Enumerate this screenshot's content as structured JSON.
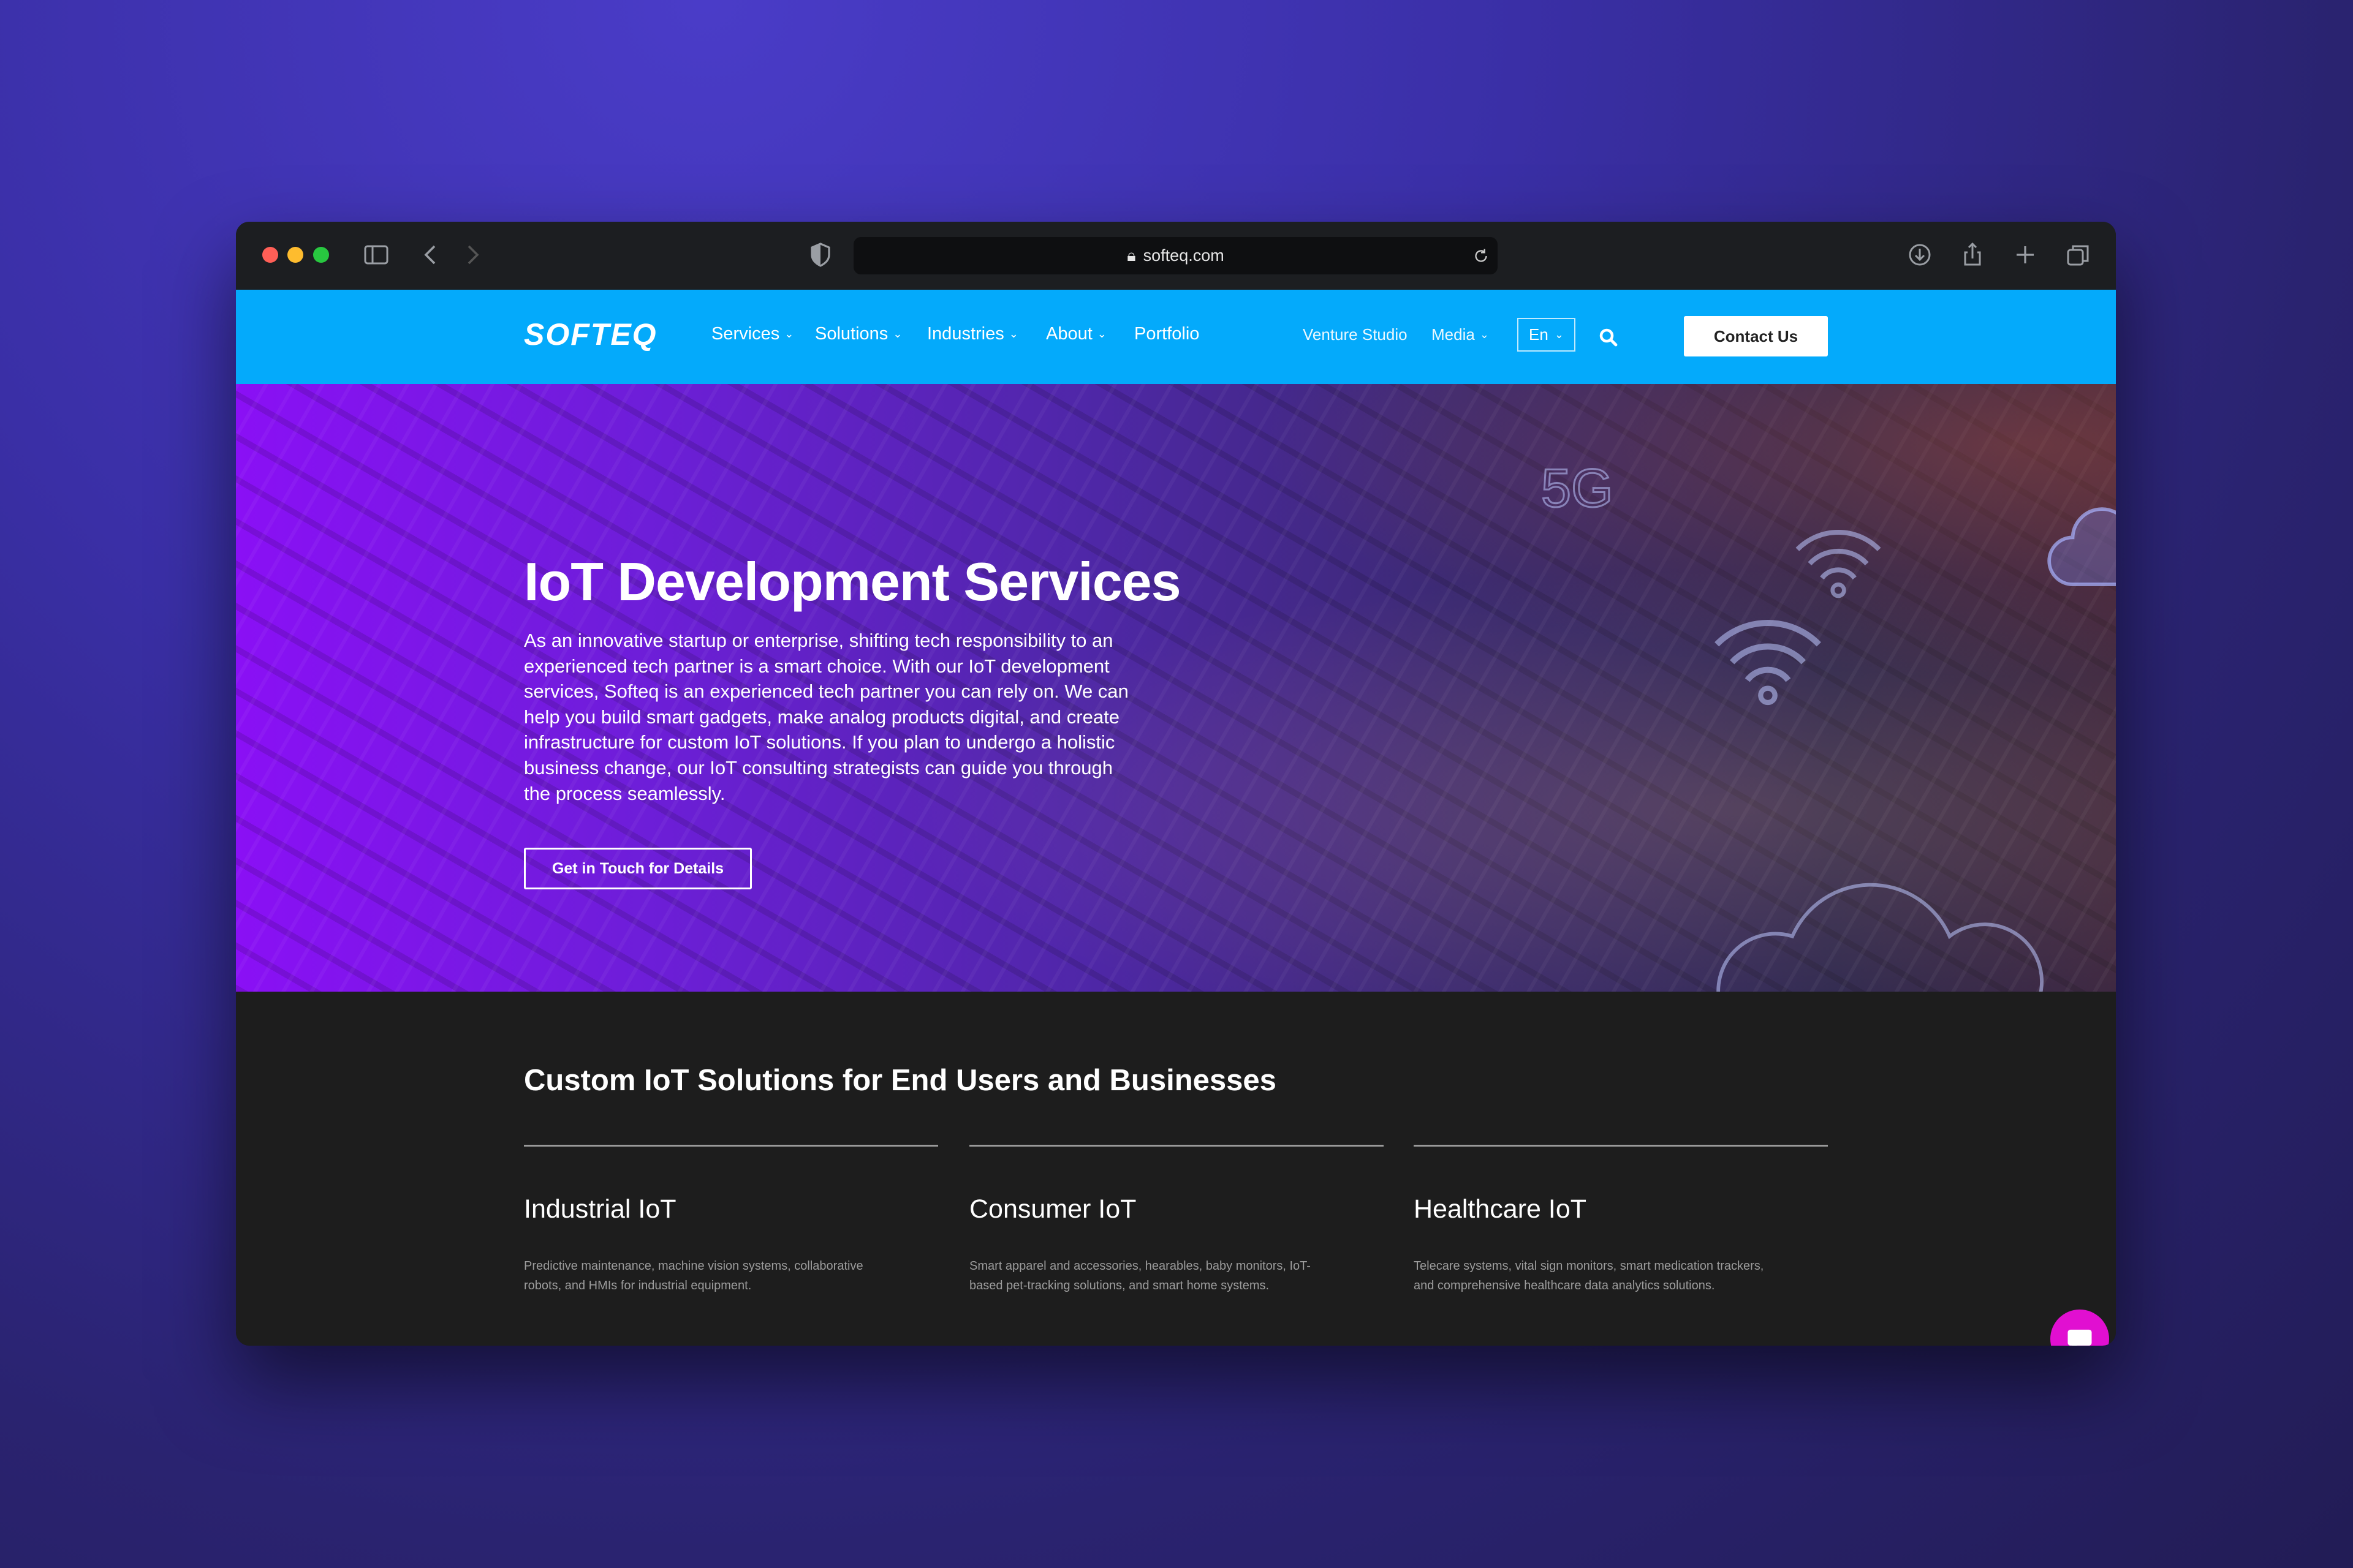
{
  "browser": {
    "url": "softeq.com",
    "traffic_lights": [
      "#ff5f57",
      "#febc2e",
      "#28c840"
    ]
  },
  "nav": {
    "logo": "SOFTEQ",
    "items": [
      {
        "label": "Services",
        "dropdown": true
      },
      {
        "label": "Solutions",
        "dropdown": true
      },
      {
        "label": "Industries",
        "dropdown": true
      },
      {
        "label": "About",
        "dropdown": true
      },
      {
        "label": "Portfolio",
        "dropdown": false
      }
    ],
    "secondary": [
      {
        "label": "Venture Studio"
      },
      {
        "label": "Media"
      }
    ],
    "language": "En",
    "contact_label": "Contact Us",
    "accent": "#04aafb"
  },
  "hero": {
    "title": "IoT Development Services",
    "description": "As an innovative startup or enterprise, shifting tech responsibility to an experienced tech partner is a smart choice. With our IoT development services, Softeq is an experienced tech partner you can rely on. We can help you build smart gadgets, make analog products digital, and create infrastructure for custom IoT solutions. If you plan to undergo a holistic business change, our IoT consulting strategists can guide you through the process seamlessly.",
    "cta_label": "Get in Touch for Details",
    "overlay_labels": [
      "5G",
      "5G"
    ]
  },
  "solutions": {
    "heading": "Custom IoT Solutions for End Users and Businesses",
    "columns": [
      {
        "title": "Industrial IoT",
        "description": "Predictive maintenance, machine vision systems, collaborative robots, and HMIs for industrial equipment."
      },
      {
        "title": "Consumer IoT",
        "description": "Smart apparel and accessories, hearables, baby monitors, IoT-based pet-tracking solutions, and smart home systems."
      },
      {
        "title": "Healthcare IoT",
        "description": "Telecare systems, vital sign monitors, smart medication trackers, and comprehensive healthcare data analytics solutions."
      }
    ]
  },
  "chat": {
    "color": "#e10fd1"
  }
}
